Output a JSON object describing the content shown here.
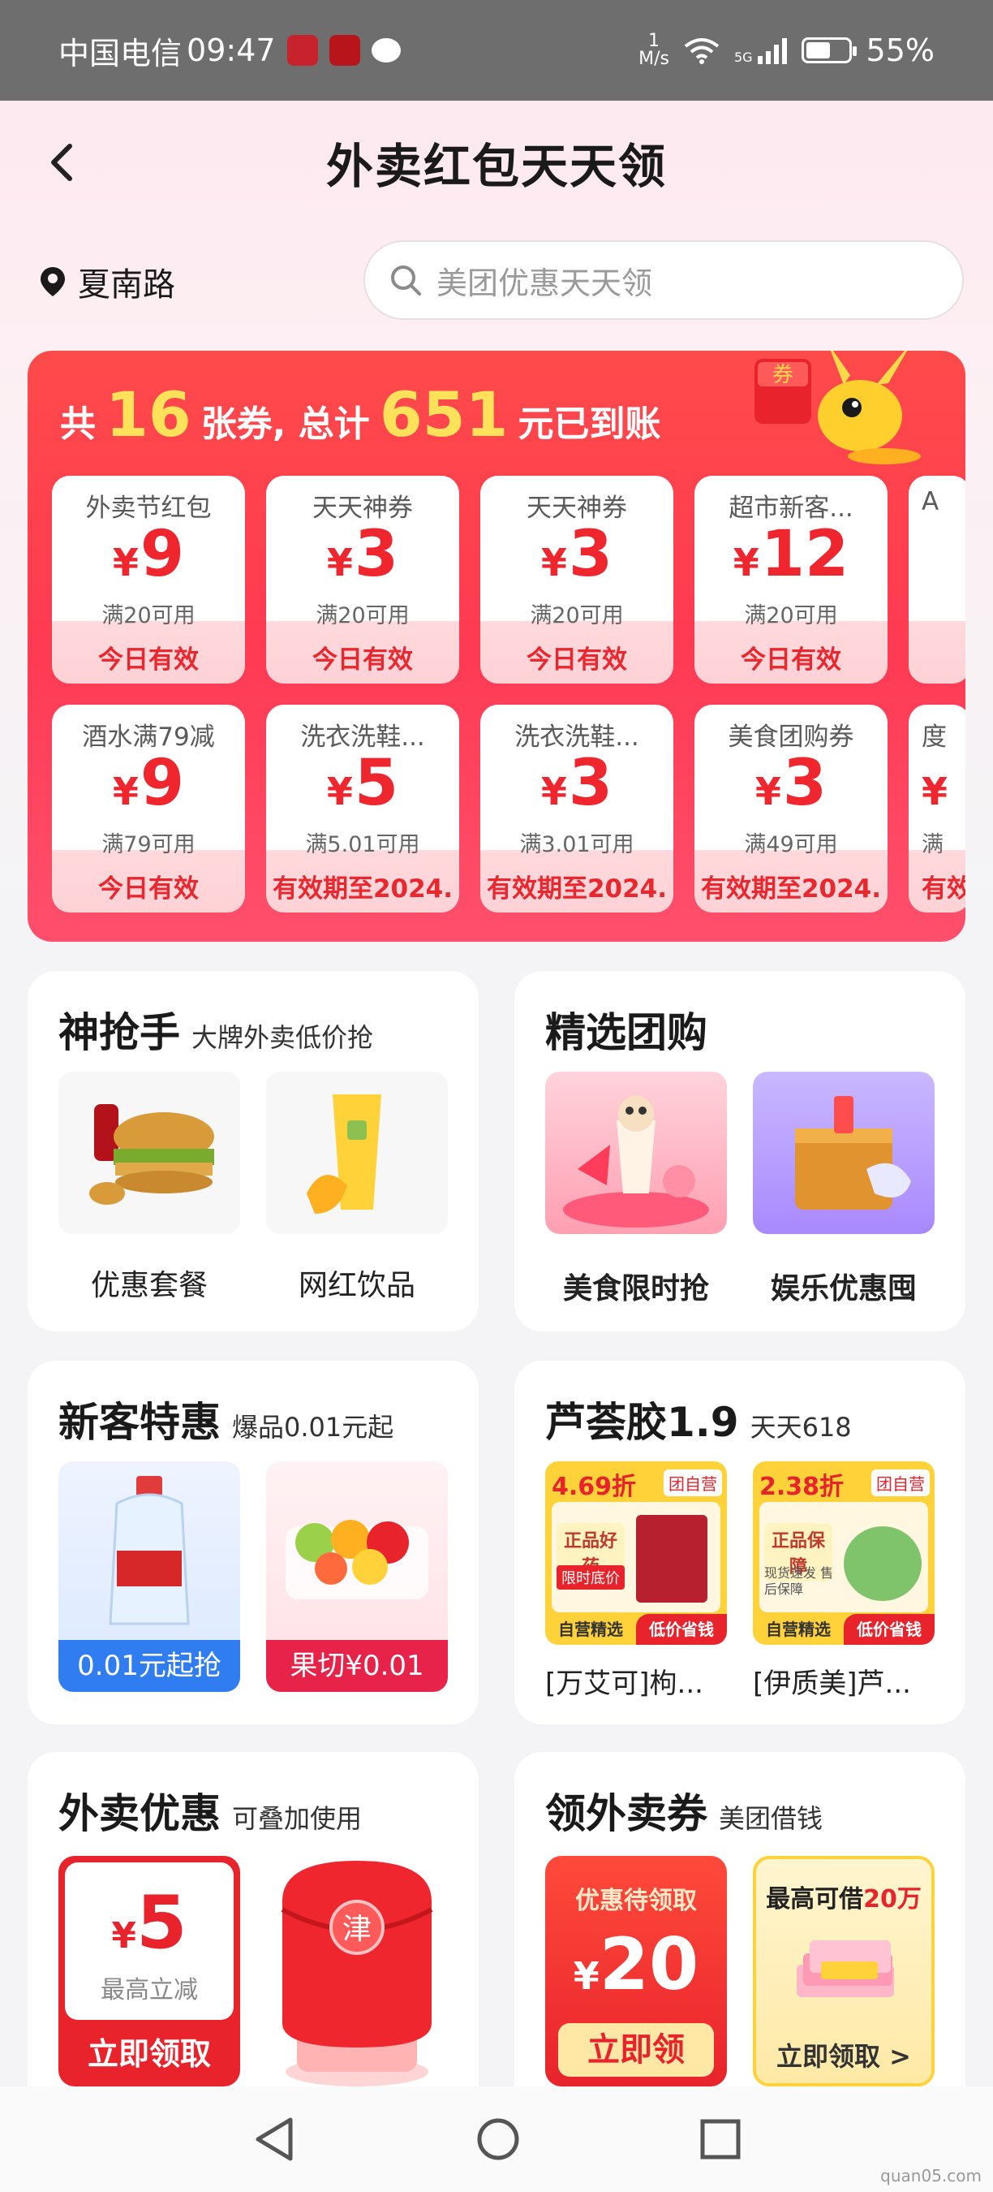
{
  "status_bar": {
    "carrier": "中国电信",
    "time": "09:47",
    "net_speed_value": "1",
    "net_speed_unit": "M/s",
    "network_type": "5G",
    "battery": "55%"
  },
  "header": {
    "title": "外卖红包天天领"
  },
  "location": {
    "name": "夏南路"
  },
  "search": {
    "placeholder": "美团优惠天天领"
  },
  "coupon_panel": {
    "prefix": "共",
    "count": "16",
    "mid": "张券, 总计",
    "total": "651",
    "suffix": "元已到账",
    "row1": [
      {
        "title": "外卖节红包",
        "currency": "¥",
        "amount": "9",
        "condition": "满20可用",
        "validity": "今日有效"
      },
      {
        "title": "天天神券",
        "currency": "¥",
        "amount": "3",
        "condition": "满20可用",
        "validity": "今日有效"
      },
      {
        "title": "天天神券",
        "currency": "¥",
        "amount": "3",
        "condition": "满20可用",
        "validity": "今日有效"
      },
      {
        "title": "超市新客...",
        "currency": "¥",
        "amount": "12",
        "condition": "满20可用",
        "validity": "今日有效"
      },
      {
        "title": "A",
        "currency": "",
        "amount": "",
        "condition": "",
        "validity": ""
      }
    ],
    "row2": [
      {
        "title": "酒水满79减",
        "currency": "¥",
        "amount": "9",
        "condition": "满79可用",
        "validity": "今日有效"
      },
      {
        "title": "洗衣洗鞋...",
        "currency": "¥",
        "amount": "5",
        "condition": "满5.01可用",
        "validity": "有效期至2024."
      },
      {
        "title": "洗衣洗鞋...",
        "currency": "¥",
        "amount": "3",
        "condition": "满3.01可用",
        "validity": "有效期至2024."
      },
      {
        "title": "美食团购券",
        "currency": "¥",
        "amount": "3",
        "condition": "满49可用",
        "validity": "有效期至2024."
      },
      {
        "title": "度",
        "currency": "¥",
        "amount": "",
        "condition": "满",
        "validity": "有效"
      }
    ]
  },
  "cards": {
    "shenqiangshou": {
      "title": "神抢手",
      "subtitle": "大牌外卖低价抢",
      "items": [
        "优惠套餐",
        "网红饮品"
      ]
    },
    "jingxuan": {
      "title": "精选团购",
      "items": [
        "美食限时抢",
        "娱乐优惠囤"
      ]
    },
    "xinke": {
      "title": "新客特惠",
      "subtitle": "爆品0.01元起",
      "items": [
        "0.01元起抢",
        "果切¥0.01"
      ]
    },
    "luhui": {
      "title": "芦荟胶1.9",
      "subtitle": "天天618",
      "items": [
        {
          "discount": "4.69折",
          "tag": "团自营",
          "badge": "正品好药",
          "badge2": "限时底价",
          "bottom_left": "自营精选",
          "bottom_right": "低价省钱",
          "label": "[万艾可]枸..."
        },
        {
          "discount": "2.38折",
          "tag": "团自营",
          "badge": "正品保障",
          "badge2": "现货速发 售后保障",
          "bottom_left": "自营精选",
          "bottom_right": "低价省钱",
          "label": "[伊质美]芦..."
        }
      ]
    },
    "waimai": {
      "title": "外卖优惠",
      "subtitle": "可叠加使用",
      "coupon_currency": "¥",
      "coupon_amount": "5",
      "coupon_note": "最高立减",
      "coupon_button": "立即领取",
      "lucky_char": "津"
    },
    "lingquan": {
      "title": "领外卖券",
      "subtitle": "美团借钱",
      "left": {
        "header": "优惠待领取",
        "currency": "¥",
        "amount": "20",
        "button": "立即领"
      },
      "right": {
        "header_prefix": "最高可借",
        "header_amount": "20万",
        "button": "立即领取 >"
      }
    }
  },
  "watermark": "quan05.com"
}
